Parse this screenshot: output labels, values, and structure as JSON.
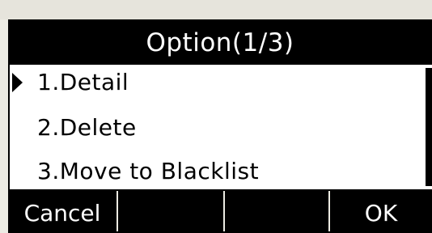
{
  "title": "Option(1/3)",
  "menu": {
    "items": [
      {
        "label": "1.Detail",
        "selected": true
      },
      {
        "label": "2.Delete",
        "selected": false
      },
      {
        "label": "3.Move to Blacklist",
        "selected": false
      }
    ]
  },
  "softkeys": {
    "key1": "Cancel",
    "key2": "",
    "key3": "",
    "key4": "OK"
  },
  "icons": {
    "selector": "triangle-right-icon"
  },
  "colors": {
    "background": "#ecebe3",
    "bar": "#000000",
    "list_bg": "#ffffff",
    "text_light": "#ffffff",
    "text_dark": "#000000"
  }
}
